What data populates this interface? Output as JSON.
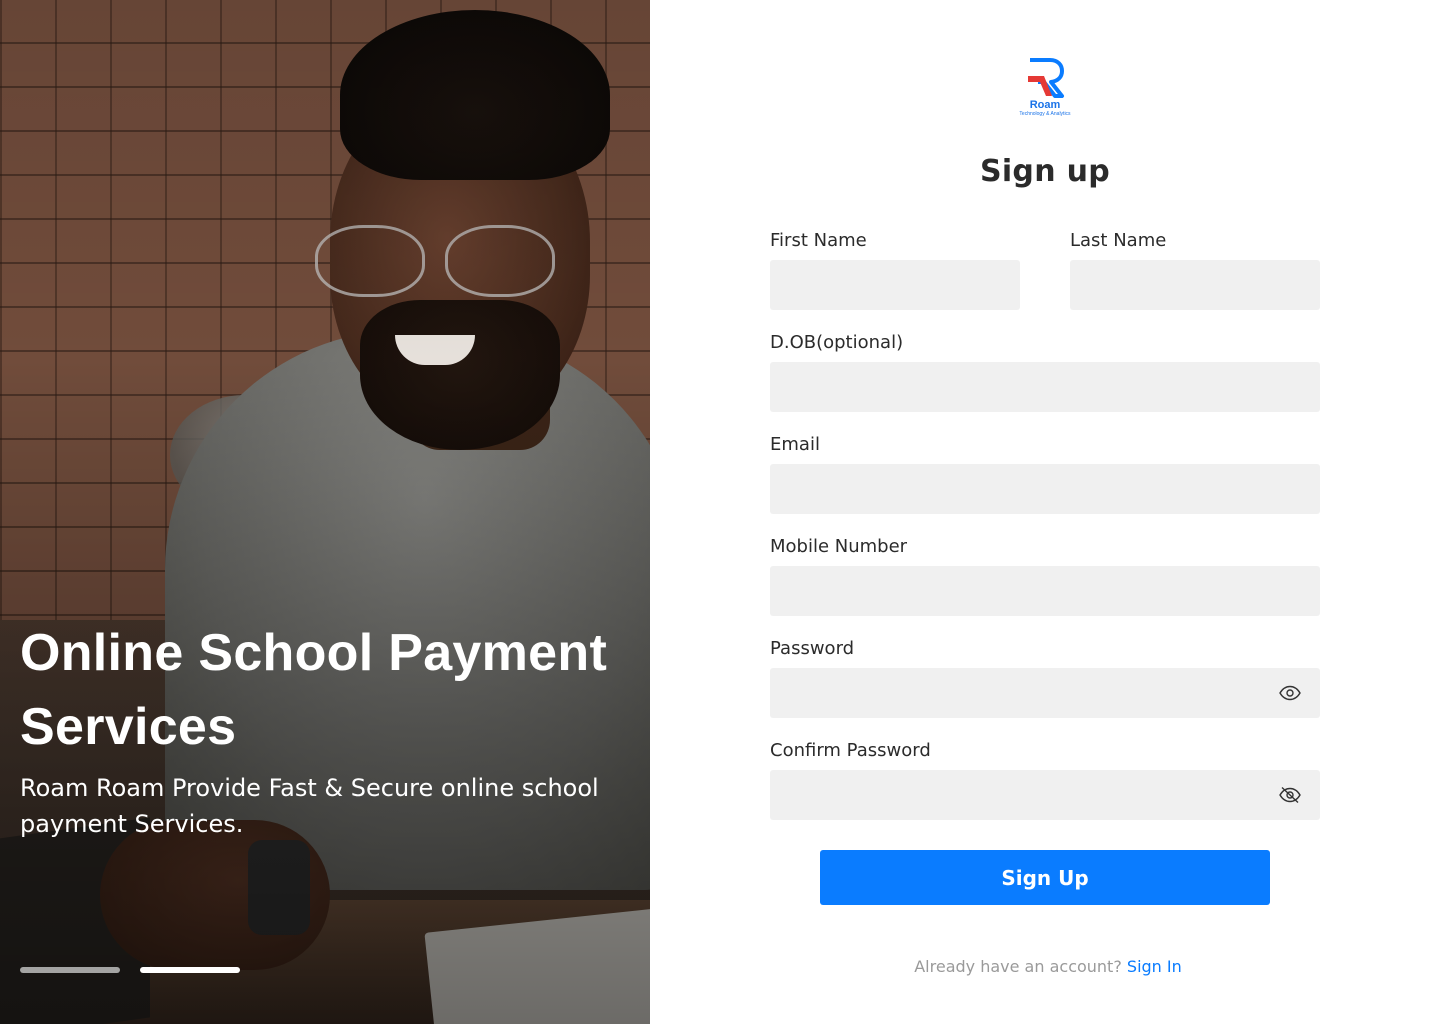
{
  "hero": {
    "title_line1": "Online School Payment",
    "title_line2": "Services",
    "subtitle_line1": "Roam Roam Provide Fast & Secure online school",
    "subtitle_line2": "payment  Services.",
    "carousel": {
      "total": 2,
      "active_index": 1
    }
  },
  "brand": {
    "name": "Roam",
    "tagline": "Technology & Analytics",
    "primary_color": "#0a7cff",
    "accent_color": "#e53935"
  },
  "form": {
    "title": "Sign up",
    "fields": {
      "first_name": {
        "label": "First Name",
        "value": ""
      },
      "last_name": {
        "label": "Last Name",
        "value": ""
      },
      "dob": {
        "label": "D.OB(optional)",
        "value": ""
      },
      "email": {
        "label": "Email",
        "value": ""
      },
      "mobile": {
        "label": "Mobile Number",
        "value": ""
      },
      "password": {
        "label": "Password",
        "value": "",
        "toggle_icon": "eye-icon"
      },
      "confirm_password": {
        "label": "Confirm Password",
        "value": "",
        "toggle_icon": "eye-slash-icon"
      }
    },
    "submit_label": "Sign Up",
    "signin_prompt": "Already have an account?",
    "signin_link": "Sign In"
  }
}
